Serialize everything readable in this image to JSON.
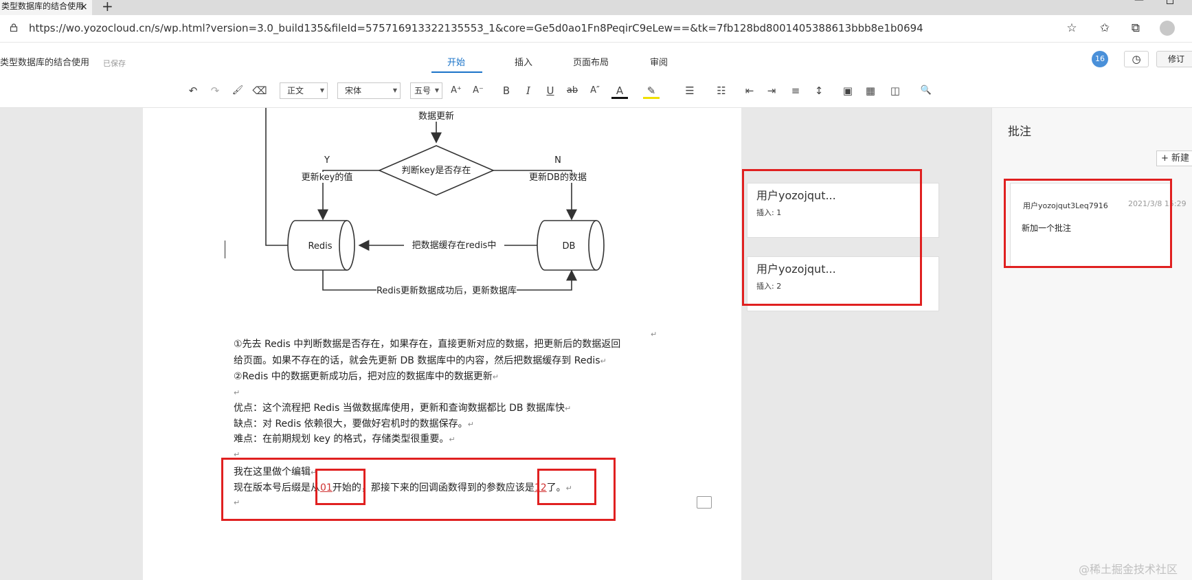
{
  "browser": {
    "tab_title": "类型数据库的结合使用",
    "tab_close": "×",
    "new_tab": "+",
    "url": "https://wo.yozocloud.cn/s/wp.html?version=3.0_build135&fileId=575716913322135553_1&core=Ge5d0ao1Fn8PeqirC9eLew==&tk=7fb128bd8001405388613bbb8e1b0694",
    "icons": [
      "lock-icon",
      "star-add-icon",
      "favorites-icon",
      "collections-icon",
      "profile-icon"
    ]
  },
  "app": {
    "doc_title": "类型数据库的结合使用",
    "save_status": "已保存",
    "menus": [
      "开始",
      "插入",
      "页面布局",
      "审阅"
    ],
    "active_menu": "开始",
    "comment_count": "16",
    "history_icon": "clock-icon",
    "revise_label": "修订"
  },
  "toolbar": {
    "style": "正文",
    "font": "宋体",
    "size": "五号",
    "buttons": {
      "undo": "↶",
      "redo": "↷",
      "format_painter": "🖌",
      "clear": "⌫",
      "grow": "A⁺",
      "shrink": "A⁻",
      "bold": "B",
      "italic": "I",
      "underline": "U",
      "strike": "ab",
      "superscript": "A″",
      "font_color": "A",
      "highlight": "✎",
      "bullets": "☰",
      "numbering": "☷",
      "outdent": "⇤",
      "indent": "⇥",
      "align": "≡",
      "spacing": "↕",
      "image": "▣",
      "table": "▦",
      "shapes": "◫",
      "search": "🔍"
    }
  },
  "diagram": {
    "labels": {
      "update": "数据更新",
      "decision": "判断key是否存在",
      "yes": "Y",
      "yes_action": "更新key的值",
      "no": "N",
      "no_action": "更新DB的数据",
      "redis": "Redis",
      "db": "DB",
      "cache": "把数据缓存在redis中",
      "after_update": "Redis更新数据成功后，更新数据库"
    }
  },
  "document": {
    "p1a": "①先去 Redis 中判断数据是否存在，如果存在，直接更新对应的数据，把更新后的数据返回",
    "p1b": "给页面。如果不存在的话，就会先更新 DB 数据库中的内容，然后把数据缓存到 Redis",
    "p2": "②Redis 中的数据更新成功后，把对应的数据库中的数据更新",
    "pros": "优点：这个流程把 Redis 当做数据库使用，更新和查询数据都比 DB 数据库快",
    "cons": "缺点：对 Redis 依赖很大，要做好宕机时的数据保存。",
    "hard": "难点：在前期规划 key 的格式，存储类型很重要。",
    "edit1": "我在这里做个编辑",
    "edit2a": "现在版本号后缀是从",
    "edit2b": "01",
    "edit2c": "开始的，那接下来的回调函数得到的参数应该是",
    "edit2d": "12",
    "edit2e": "了。",
    "para_mark": "↵"
  },
  "revisions": [
    {
      "user": "用户yozojqut...",
      "action": "插入: 1"
    },
    {
      "user": "用户yozojqut...",
      "action": "插入: 2"
    }
  ],
  "comments_panel": {
    "title": "批注",
    "new_label": "+ 新建",
    "comment": {
      "user": "用户yozojqut3Leq7916",
      "date": "2021/3/8 15:29",
      "body": "新加一个批注"
    }
  },
  "watermark": "@稀土掘金技术社区"
}
